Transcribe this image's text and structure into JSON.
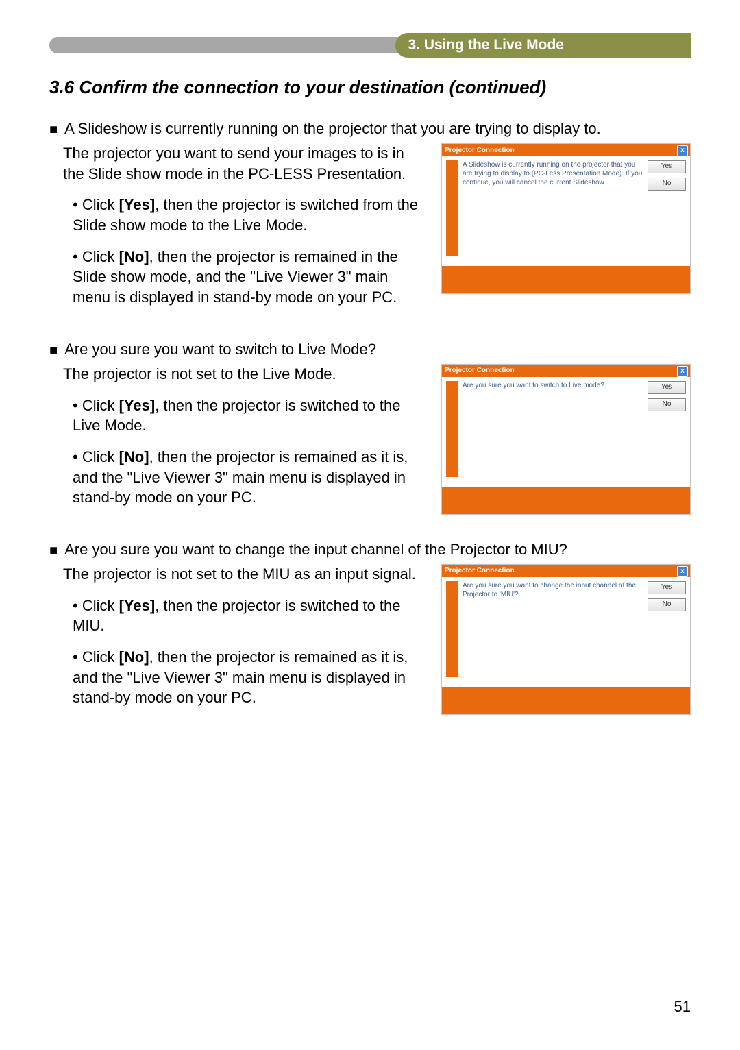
{
  "header": {
    "chapter": "3. Using the Live Mode"
  },
  "section_title": "3.6 Confirm the connection to your destination (continued)",
  "s1": {
    "heading": "A Slideshow is currently running on the projector that you are trying to display to.",
    "intro": "The projector you want to send your images to is in the Slide show mode in the PC-LESS Presentation.",
    "yes": {
      "prefix": "• Click ",
      "label": "[Yes]",
      "text": ", then the projector is switched from the Slide show mode to the Live Mode."
    },
    "no": {
      "prefix": "• Click ",
      "label": "[No]",
      "text": ", then the projector is remained in the Slide show mode, and the \"Live Viewer 3\" main menu is displayed in stand-by mode on your PC."
    }
  },
  "s2": {
    "heading": "Are you sure you want to switch to Live Mode?",
    "intro": "The projector is not set to the Live Mode.",
    "yes": {
      "prefix": "• Click ",
      "label": "[Yes]",
      "text": ", then the projector is switched to the Live Mode."
    },
    "no": {
      "prefix": "• Click ",
      "label": "[No]",
      "text": ", then the projector is remained as it is, and the \"Live Viewer 3\" main menu is displayed in stand-by mode on your PC."
    }
  },
  "s3": {
    "heading": "Are you sure you want to change the input channel of the Projector to MIU?",
    "intro": "The projector is not set to the MIU as an input signal.",
    "yes": {
      "prefix": "• Click ",
      "label": "[Yes]",
      "text": ", then the projector is switched to the MIU."
    },
    "no": {
      "prefix": "• Click ",
      "label": "[No]",
      "text": ", then the projector is remained as it is, and the \"Live Viewer 3\" main menu is displayed in stand-by mode on your PC."
    }
  },
  "dialog": {
    "title": "Projector Connection",
    "close": "x",
    "yes": "Yes",
    "no": "No",
    "msg1": "A Slideshow is currently running on the projector that you are trying to display to (PC-Less Presentation Mode). If you continue, you will cancel the current Slideshow.",
    "msg2": "Are you sure you want to switch to Live mode?",
    "msg3": "Are you sure you want to change the input channel of the Projector to 'MIU'?"
  },
  "page_no": "51"
}
